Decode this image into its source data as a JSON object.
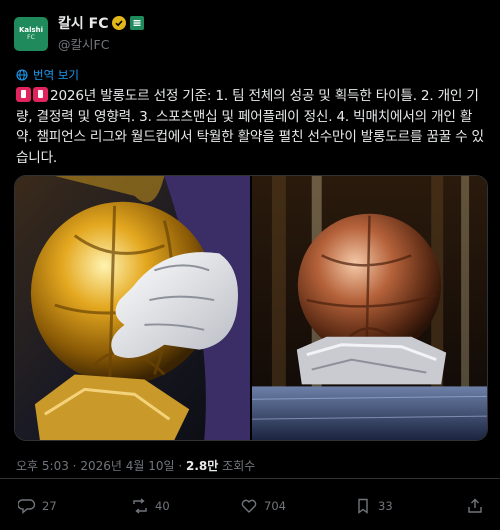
{
  "account": {
    "avatar_line1": "Kalshi",
    "avatar_line2": "FC",
    "display_name": "칼시 FC",
    "handle": "@칼시FC"
  },
  "translate_label": "번역 보기",
  "post": {
    "text": "2026년 발롱도르 선정 기준: 1. 팀 전체의 성공 및 획득한 타이틀. 2. 개인 기량, 결정력 및 영향력. 3. 스포츠맨십 및 페어플레이 정신. 4. 빅매치에서의 개인 활약. 챔피언스 리그와 월드컵에서 탁월한 활약을 펼친 선수만이 발롱도르를 꿈꿀 수 있습니다."
  },
  "meta": {
    "time": "오후 5:03",
    "sep1": "·",
    "date": "2026년 4월 10일",
    "sep2": "·",
    "views_count": "2.8만",
    "views_label": "조회수"
  },
  "actions": {
    "replies": "27",
    "reposts": "40",
    "likes": "704",
    "bookmarks": "33"
  },
  "colors": {
    "accent": "#1d9bf0",
    "verified": "#e2b719",
    "brand": "#1f8a5b"
  }
}
